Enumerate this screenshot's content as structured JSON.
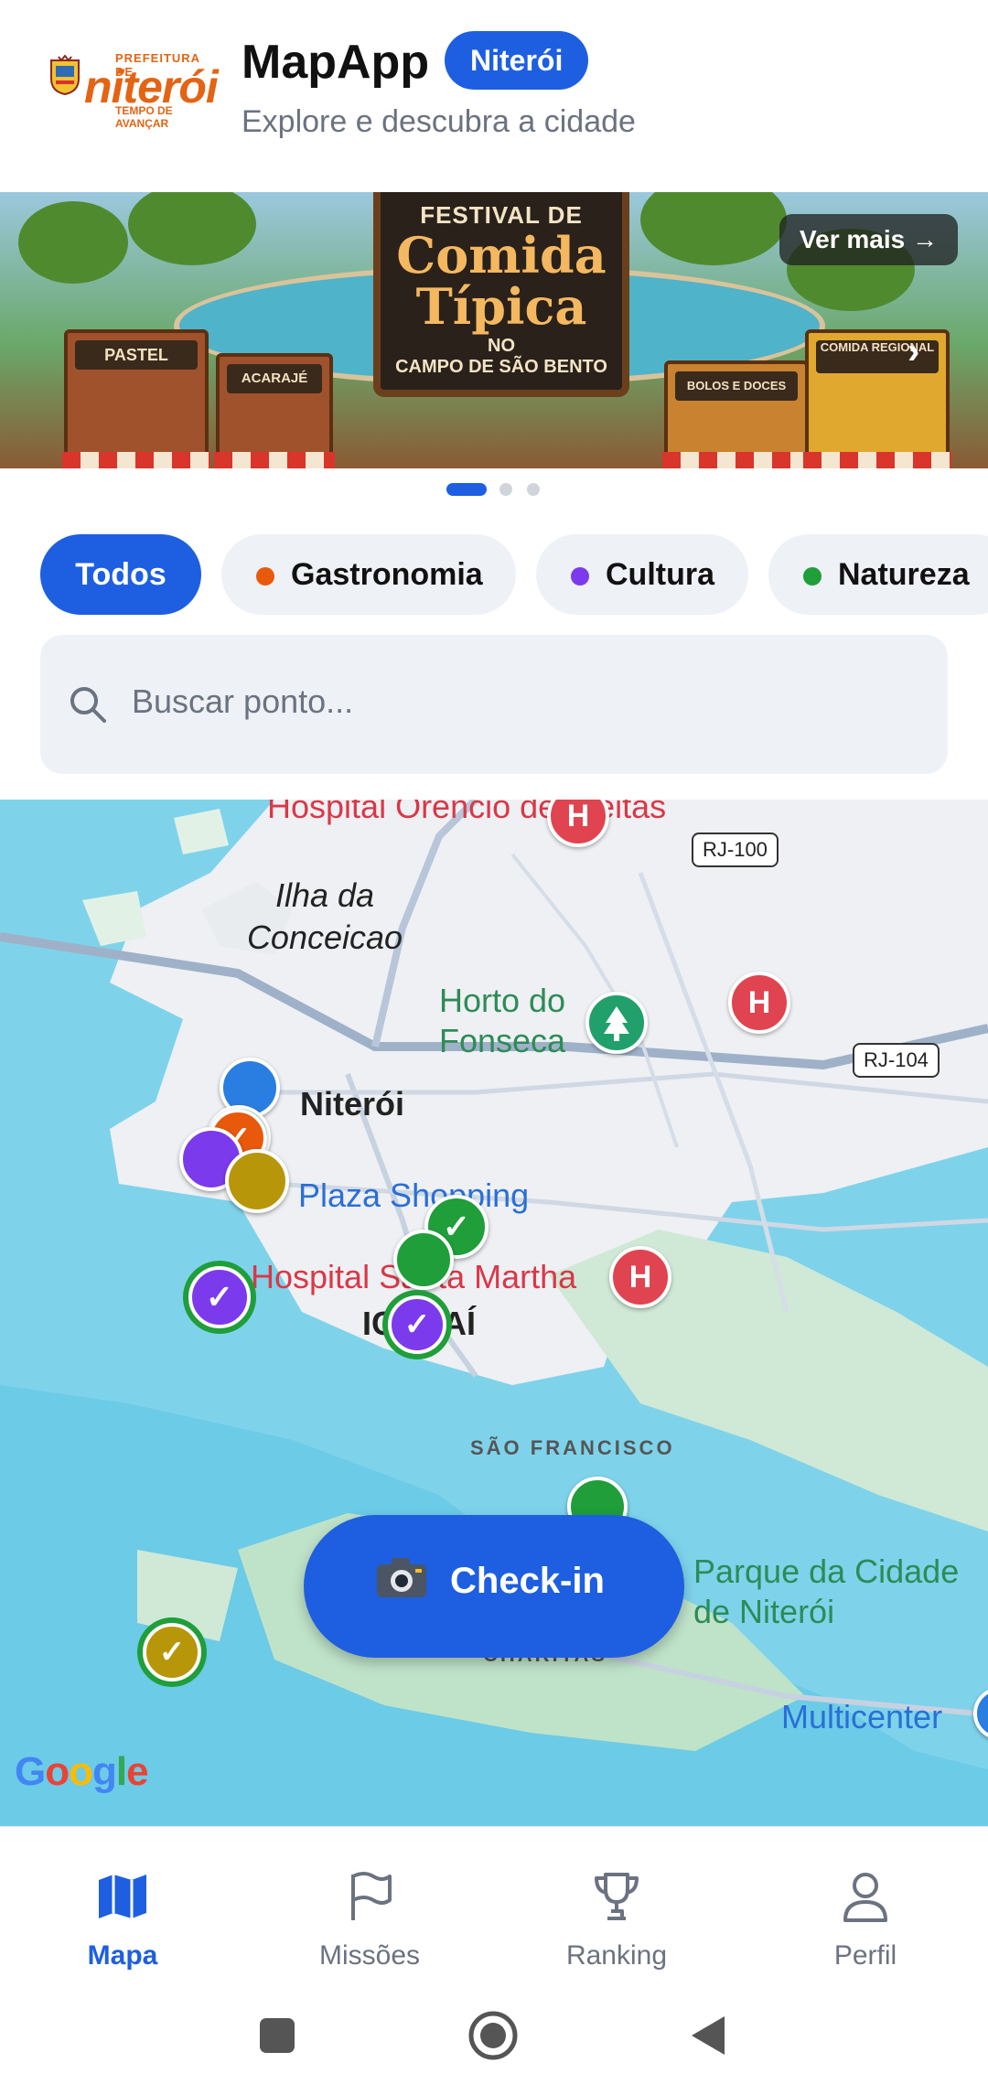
{
  "header": {
    "logo": {
      "top_text": "PREFEITURA DE",
      "name": "niterói",
      "slogan": "TEMPO DE AVANÇAR"
    },
    "app_title": "MapApp",
    "city_badge": "Niterói",
    "subtitle": "Explore e descubra a cidade"
  },
  "banner": {
    "board": {
      "line1": "FESTIVAL DE",
      "line2": "Comida",
      "line3": "Típica",
      "line4": "NO",
      "line5": "CAMPO DE SÃO BENTO"
    },
    "stalls": [
      "PASTEL",
      "ACARAJÉ",
      "BOLOS E DOCES",
      "COMIDA REGIONAL"
    ],
    "cta": "Ver mais →",
    "next_icon": "chevron-right-icon",
    "pagination": {
      "count": 3,
      "active": 0
    }
  },
  "filters": {
    "chips": [
      {
        "label": "Todos",
        "active": true
      },
      {
        "label": "Gastronomia",
        "color": "#e8590c"
      },
      {
        "label": "Cultura",
        "color": "#7c3aed"
      },
      {
        "label": "Natureza",
        "color": "#1f9e3a"
      }
    ]
  },
  "search": {
    "placeholder": "Buscar ponto...",
    "icon": "search-icon"
  },
  "map": {
    "labels": {
      "hospital_orencio": "Hospital Orencio de Freitas",
      "rj100": "RJ-100",
      "ilha": "Ilha da Conceicao",
      "horto": "Horto do Fonseca",
      "rj104": "RJ-104",
      "niteroi": "Niterói",
      "plaza": "Plaza Shopping",
      "santa_martha": "Hospital Santa Martha",
      "icarai": "ICARAÍ",
      "sao_francisco": "SÃO FRANCISCO",
      "parque": "Parque da Cidade de Niterói",
      "charitas": "CHARITAS",
      "multicenter": "Multicenter",
      "google": "Google"
    },
    "checkin_button": "Check-in",
    "checkmark": "✓"
  },
  "bottom_nav": {
    "items": [
      {
        "label": "Mapa",
        "icon": "map-icon",
        "active": true
      },
      {
        "label": "Missões",
        "icon": "flag-icon"
      },
      {
        "label": "Ranking",
        "icon": "trophy-icon"
      },
      {
        "label": "Perfil",
        "icon": "user-icon"
      }
    ]
  },
  "colors": {
    "primary": "#1d5fe0",
    "gastronomia": "#e8590c",
    "cultura": "#7c3aed",
    "natureza": "#1f9e3a",
    "hospital": "#e04450",
    "gold": "#b8960a"
  }
}
